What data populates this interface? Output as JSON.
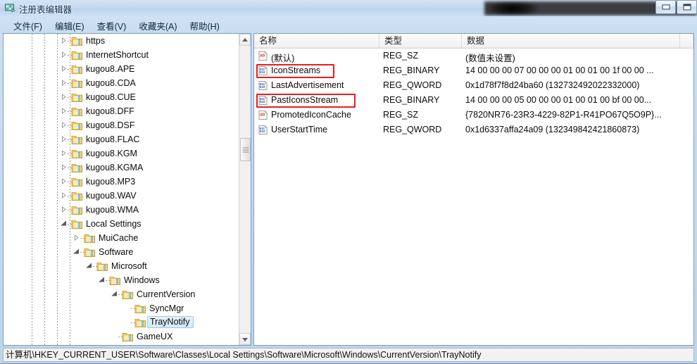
{
  "window": {
    "title": "注册表编辑器",
    "app_icon": "registry-editor-icon",
    "redaction_note": "",
    "buttons": {
      "minimize": "最小化",
      "maximize": "最大化"
    }
  },
  "menu": {
    "items": [
      {
        "label": "文件(F)",
        "name": "menu-file"
      },
      {
        "label": "编辑(E)",
        "name": "menu-edit"
      },
      {
        "label": "查看(V)",
        "name": "menu-view"
      },
      {
        "label": "收藏夹(A)",
        "name": "menu-favorites"
      },
      {
        "label": "帮助(H)",
        "name": "menu-help"
      }
    ]
  },
  "tree": {
    "nodes": [
      {
        "label": "https",
        "depth": 4,
        "expander": "collapsed",
        "selected": false
      },
      {
        "label": "InternetShortcut",
        "depth": 4,
        "expander": "collapsed",
        "selected": false
      },
      {
        "label": "kugou8.APE",
        "depth": 4,
        "expander": "collapsed",
        "selected": false
      },
      {
        "label": "kugou8.CDA",
        "depth": 4,
        "expander": "collapsed",
        "selected": false
      },
      {
        "label": "kugou8.CUE",
        "depth": 4,
        "expander": "collapsed",
        "selected": false
      },
      {
        "label": "kugou8.DFF",
        "depth": 4,
        "expander": "collapsed",
        "selected": false
      },
      {
        "label": "kugou8.DSF",
        "depth": 4,
        "expander": "collapsed",
        "selected": false
      },
      {
        "label": "kugou8.FLAC",
        "depth": 4,
        "expander": "collapsed",
        "selected": false
      },
      {
        "label": "kugou8.KGM",
        "depth": 4,
        "expander": "collapsed",
        "selected": false
      },
      {
        "label": "kugou8.KGMA",
        "depth": 4,
        "expander": "collapsed",
        "selected": false
      },
      {
        "label": "kugou8.MP3",
        "depth": 4,
        "expander": "collapsed",
        "selected": false
      },
      {
        "label": "kugou8.WAV",
        "depth": 4,
        "expander": "collapsed",
        "selected": false
      },
      {
        "label": "kugou8.WMA",
        "depth": 4,
        "expander": "collapsed",
        "selected": false
      },
      {
        "label": "Local Settings",
        "depth": 4,
        "expander": "expanded",
        "selected": false
      },
      {
        "label": "MuiCache",
        "depth": 5,
        "expander": "collapsed",
        "selected": false
      },
      {
        "label": "Software",
        "depth": 5,
        "expander": "expanded",
        "selected": false
      },
      {
        "label": "Microsoft",
        "depth": 6,
        "expander": "expanded",
        "selected": false
      },
      {
        "label": "Windows",
        "depth": 7,
        "expander": "expanded",
        "selected": false
      },
      {
        "label": "CurrentVersion",
        "depth": 8,
        "expander": "expanded",
        "selected": false
      },
      {
        "label": "SyncMgr",
        "depth": 9,
        "expander": "none",
        "selected": false
      },
      {
        "label": "TrayNotify",
        "depth": 9,
        "expander": "none",
        "selected": true
      },
      {
        "label": "GameUX",
        "depth": 8,
        "expander": "none",
        "selected": false
      }
    ],
    "scrollbar": {
      "up_arrow": "向上",
      "down_arrow": "向下"
    }
  },
  "list": {
    "columns": [
      {
        "label": "名称",
        "name": "column-name"
      },
      {
        "label": "类型",
        "name": "column-type"
      },
      {
        "label": "数据",
        "name": "column-data"
      }
    ],
    "rows": [
      {
        "name": "(默认)",
        "type": "REG_SZ",
        "data": "(数值未设置)",
        "icon": "string-value-icon",
        "highlighted": false
      },
      {
        "name": "IconStreams",
        "type": "REG_BINARY",
        "data": "14 00 00 00 07 00 00 00 01 00 01 00 1f 00 00 ...",
        "icon": "binary-value-icon",
        "highlighted": true
      },
      {
        "name": "LastAdvertisement",
        "type": "REG_QWORD",
        "data": "0x1d78f7f8d24ba60 (132732492022332000)",
        "icon": "binary-value-icon",
        "highlighted": false
      },
      {
        "name": "PastIconsStream",
        "type": "REG_BINARY",
        "data": "14 00 00 00 05 00 00 00 01 00 01 00 bf 00 00...",
        "icon": "binary-value-icon",
        "highlighted": true
      },
      {
        "name": "PromotedIconCache",
        "type": "REG_SZ",
        "data": "{7820NR76-23R3-4229-82P1-R41PO67Q5O9P}...",
        "icon": "string-value-icon",
        "highlighted": false
      },
      {
        "name": "UserStartTime",
        "type": "REG_QWORD",
        "data": "0x1d6337affa24a09 (132349842421860873)",
        "icon": "binary-value-icon",
        "highlighted": false
      }
    ]
  },
  "statusbar": {
    "path": "计算机\\HKEY_CURRENT_USER\\Software\\Classes\\Local Settings\\Software\\Microsoft\\Windows\\CurrentVersion\\TrayNotify"
  },
  "colors": {
    "highlight_box": "#ee1c1c",
    "selection_bg": "#d6ebfb",
    "selection_border": "#9dc6e8",
    "title_bar": "#c6dbef",
    "folder": "#f7d275"
  }
}
